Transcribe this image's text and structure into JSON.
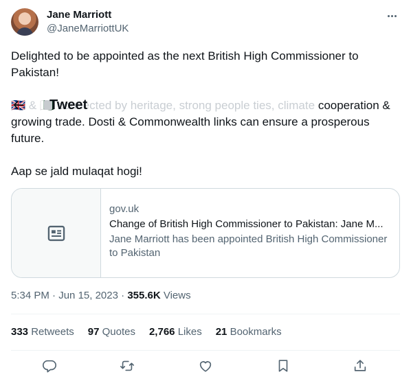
{
  "author": {
    "name": "Jane Marriott",
    "handle": "@JaneMarriottUK"
  },
  "tweet": {
    "line1": "Delighted to be appointed as the next British High Commissioner to Pakistan!",
    "line2_faded_prefix": "🇬🇧 & 🇵🇰 connected by heritage, strong people ties, climate",
    "line2_rest": "cooperation & growing trade. Dosti & Commonwealth links can ensure a prosperous future.",
    "line3": "Aap se jald mulaqat hogi!"
  },
  "header": {
    "title": "Tweet"
  },
  "card": {
    "domain": "gov.uk",
    "title": "Change of British High Commissioner to Pakistan: Jane M...",
    "description": "Jane Marriott has been appointed British High Commissioner to Pakistan"
  },
  "meta": {
    "time": "5:34 PM",
    "date": "Jun 15, 2023",
    "views_count": "355.6K",
    "views_label": "Views"
  },
  "stats": {
    "retweets_count": "333",
    "retweets_label": "Retweets",
    "quotes_count": "97",
    "quotes_label": "Quotes",
    "likes_count": "2,766",
    "likes_label": "Likes",
    "bookmarks_count": "21",
    "bookmarks_label": "Bookmarks"
  },
  "icons": {
    "more": "more-icon",
    "back": "back-arrow-icon",
    "article": "article-icon",
    "reply": "reply-icon",
    "retweet": "retweet-icon",
    "like": "like-icon",
    "bookmark": "bookmark-icon",
    "share": "share-icon"
  },
  "colors": {
    "text": "#0f1419",
    "secondary": "#536471",
    "border": "#cfd9de"
  }
}
